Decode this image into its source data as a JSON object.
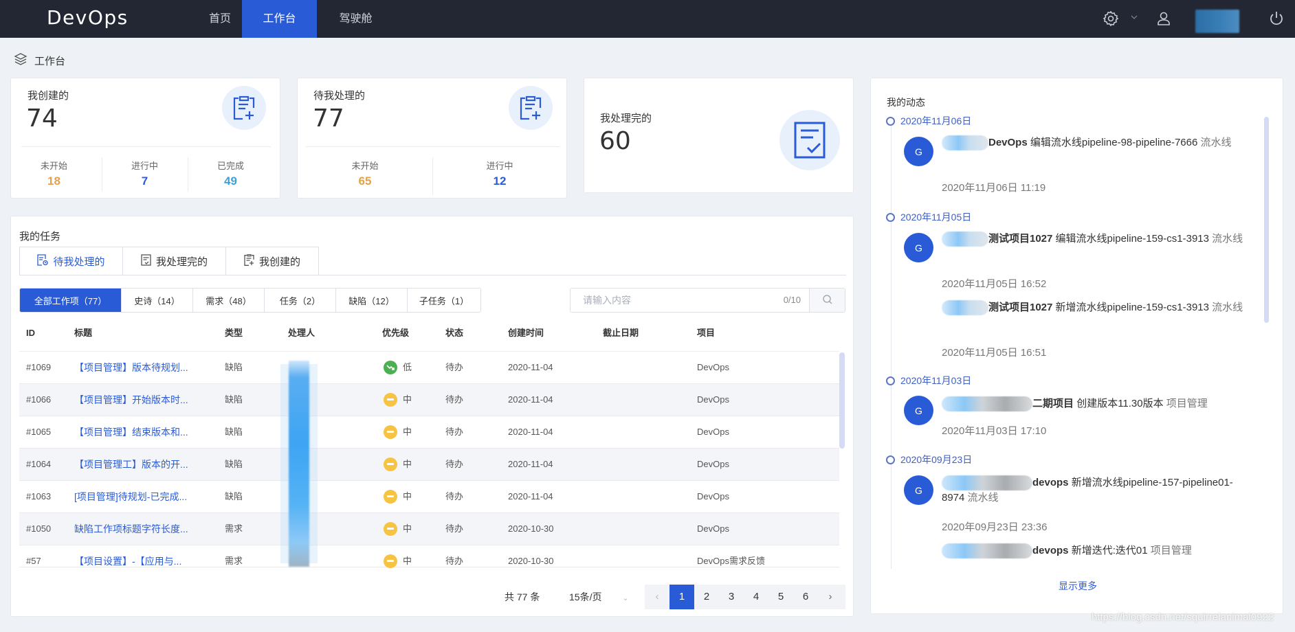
{
  "app": {
    "logo": "DevOps"
  },
  "nav": {
    "items": [
      {
        "label": "首页",
        "active": false
      },
      {
        "label": "工作台",
        "active": true
      },
      {
        "label": "驾驶舱",
        "active": false
      }
    ],
    "icons": [
      "settings-icon",
      "chevron-down-icon",
      "user-icon",
      "power-icon"
    ]
  },
  "breadcrumb": {
    "label": "工作台",
    "icon": "layers-icon"
  },
  "stats": [
    {
      "title": "我创建的",
      "value": "74",
      "icon": "clipboard-add-icon",
      "sub": [
        {
          "label": "未开始",
          "value": "18",
          "color": "#e4a04a"
        },
        {
          "label": "进行中",
          "value": "7",
          "color": "#2a5bd7"
        },
        {
          "label": "已完成",
          "value": "49",
          "color": "#3fa0d8"
        }
      ]
    },
    {
      "title": "待我处理的",
      "value": "77",
      "icon": "clipboard-add-icon",
      "sub": [
        {
          "label": "未开始",
          "value": "65",
          "color": "#e4a04a"
        },
        {
          "label": "进行中",
          "value": "12",
          "color": "#2a5bd7"
        }
      ]
    },
    {
      "title": "我处理完的",
      "value": "60",
      "icon": "document-check-icon",
      "sub": []
    }
  ],
  "tasks": {
    "title": "我的任务",
    "tabs": [
      {
        "label": "待我处理的",
        "active": true
      },
      {
        "label": "我处理完的",
        "active": false
      },
      {
        "label": "我创建的",
        "active": false
      }
    ],
    "filters": [
      {
        "label": "全部工作项（77）",
        "active": true
      },
      {
        "label": "史诗（14）",
        "active": false
      },
      {
        "label": "需求（48）",
        "active": false
      },
      {
        "label": "任务（2）",
        "active": false
      },
      {
        "label": "缺陷（12）",
        "active": false
      },
      {
        "label": "子任务（1）",
        "active": false
      }
    ],
    "search": {
      "placeholder": "请输入内容",
      "value": "",
      "count": "0/10"
    },
    "columns": [
      "ID",
      "标题",
      "类型",
      "处理人",
      "优先级",
      "状态",
      "创建时间",
      "截止日期",
      "项目"
    ],
    "rows": [
      {
        "id": "#1069",
        "title": "【项目管理】版本待规划...",
        "type": "缺陷",
        "assignee": "",
        "priority": "低",
        "priority_level": "low",
        "status": "待办",
        "created": "2020-11-04",
        "due": "",
        "project": "DevOps"
      },
      {
        "id": "#1066",
        "title": "【项目管理】开始版本时...",
        "type": "缺陷",
        "assignee": "",
        "priority": "中",
        "priority_level": "mid",
        "status": "待办",
        "created": "2020-11-04",
        "due": "",
        "project": "DevOps"
      },
      {
        "id": "#1065",
        "title": "【项目管理】结束版本和...",
        "type": "缺陷",
        "assignee": "",
        "priority": "中",
        "priority_level": "mid",
        "status": "待办",
        "created": "2020-11-04",
        "due": "",
        "project": "DevOps"
      },
      {
        "id": "#1064",
        "title": "【项目管理工】版本的开...",
        "type": "缺陷",
        "assignee": "",
        "priority": "中",
        "priority_level": "mid",
        "status": "待办",
        "created": "2020-11-04",
        "due": "",
        "project": "DevOps"
      },
      {
        "id": "#1063",
        "title": "[项目管理]待规划-已完成...",
        "type": "缺陷",
        "assignee": "",
        "priority": "中",
        "priority_level": "mid",
        "status": "待办",
        "created": "2020-11-04",
        "due": "",
        "project": "DevOps"
      },
      {
        "id": "#1050",
        "title": "缺陷工作项标题字符长度...",
        "type": "需求",
        "assignee": "",
        "priority": "中",
        "priority_level": "mid",
        "status": "待办",
        "created": "2020-10-30",
        "due": "",
        "project": "DevOps"
      },
      {
        "id": "#57",
        "title": "【项目设置】-【应用与...",
        "type": "需求",
        "assignee": "",
        "priority": "中",
        "priority_level": "mid",
        "status": "待办",
        "created": "2020-10-30",
        "due": "",
        "project": "DevOps需求反馈"
      }
    ],
    "pagination": {
      "total_label": "共 77 条",
      "page_size": "15条/页",
      "pages": [
        "1",
        "2",
        "3",
        "4",
        "5",
        "6"
      ],
      "current": 1
    }
  },
  "activity": {
    "title": "我的动态",
    "groups": [
      {
        "date": "2020年11月06日",
        "entries": [
          {
            "avatar": "G",
            "subject": "DevOps",
            "action": "编辑流水线pipeline-98-pipeline-7666",
            "category": "流水线",
            "time": "2020年11月06日 11:19"
          }
        ]
      },
      {
        "date": "2020年11月05日",
        "entries": [
          {
            "avatar": "G",
            "subject": "测试项目1027",
            "action": "编辑流水线pipeline-159-cs1-3913",
            "category": "流水线",
            "time": "2020年11月05日 16:52"
          },
          {
            "avatar": "",
            "subject": "测试项目1027",
            "action": "新增流水线pipeline-159-cs1-3913",
            "category": "流水线",
            "time": "2020年11月05日 16:51"
          }
        ]
      },
      {
        "date": "2020年11月03日",
        "entries": [
          {
            "avatar": "G",
            "subject": "二期项目",
            "action": "创建版本11.30版本",
            "category": "项目管理",
            "time": "2020年11月03日 17:10"
          }
        ]
      },
      {
        "date": "2020年09月23日",
        "entries": [
          {
            "avatar": "G",
            "subject": "devops",
            "action": "新增流水线pipeline-157-pipeline01-8974",
            "category": "流水线",
            "time": "2020年09月23日 23:36"
          },
          {
            "avatar": "",
            "subject": "devops",
            "action": "新增迭代:迭代01",
            "category": "项目管理",
            "time": ""
          }
        ]
      }
    ],
    "show_more": "显示更多"
  },
  "watermark": "https://blog.csdn.net/squirrelanimal0922"
}
